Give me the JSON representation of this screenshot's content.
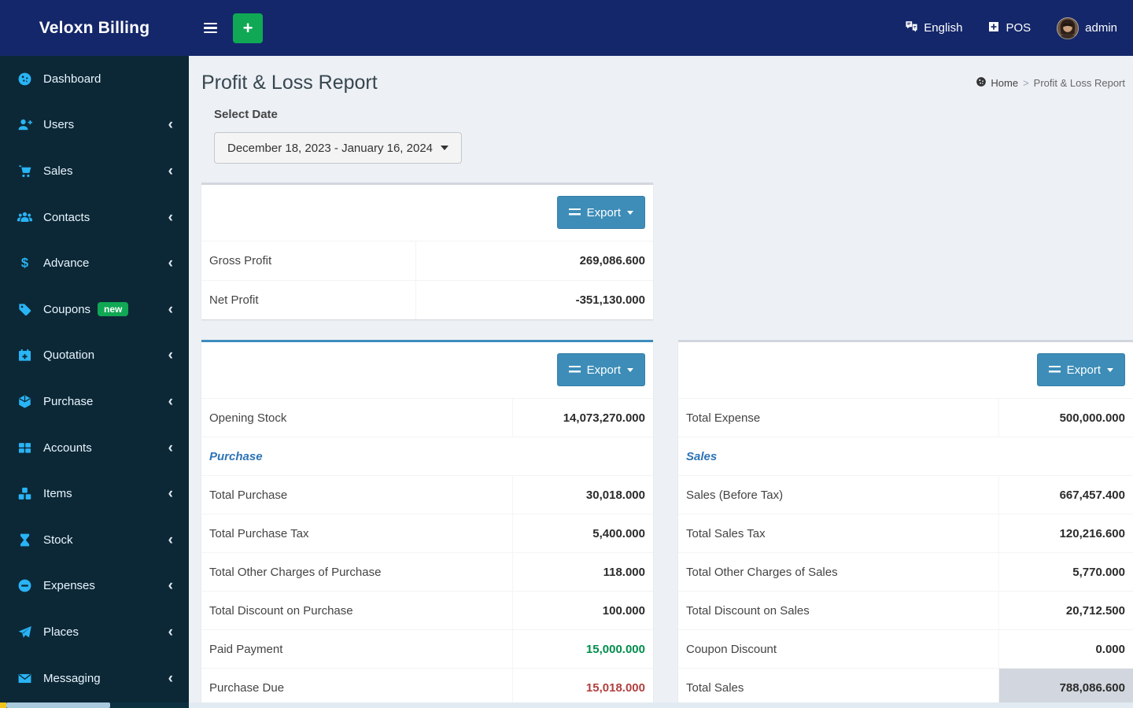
{
  "app": {
    "title": "Veloxn Billing"
  },
  "navbar": {
    "language_label": "English",
    "pos_label": "POS",
    "user_name": "admin"
  },
  "sidebar": {
    "items": [
      {
        "id": "dashboard",
        "label": "Dashboard",
        "icon": "dashboard-icon",
        "chevron": false
      },
      {
        "id": "users",
        "label": "Users",
        "icon": "users-icon",
        "chevron": true
      },
      {
        "id": "sales",
        "label": "Sales",
        "icon": "sales-icon",
        "chevron": true
      },
      {
        "id": "contacts",
        "label": "Contacts",
        "icon": "contacts-icon",
        "chevron": true
      },
      {
        "id": "advance",
        "label": "Advance",
        "icon": "advance-icon",
        "chevron": true
      },
      {
        "id": "coupons",
        "label": "Coupons",
        "icon": "coupons-icon",
        "chevron": true,
        "badge": "new"
      },
      {
        "id": "quotation",
        "label": "Quotation",
        "icon": "quotation-icon",
        "chevron": true
      },
      {
        "id": "purchase",
        "label": "Purchase",
        "icon": "purchase-icon",
        "chevron": true
      },
      {
        "id": "accounts",
        "label": "Accounts",
        "icon": "accounts-icon",
        "chevron": true
      },
      {
        "id": "items",
        "label": "Items",
        "icon": "items-icon",
        "chevron": true
      },
      {
        "id": "stock",
        "label": "Stock",
        "icon": "stock-icon",
        "chevron": true
      },
      {
        "id": "expenses",
        "label": "Expenses",
        "icon": "expenses-icon",
        "chevron": true
      },
      {
        "id": "places",
        "label": "Places",
        "icon": "places-icon",
        "chevron": true
      },
      {
        "id": "messaging",
        "label": "Messaging",
        "icon": "messaging-icon",
        "chevron": true
      }
    ]
  },
  "page": {
    "title": "Profit & Loss Report",
    "breadcrumb": {
      "home": "Home",
      "separator": ">",
      "current": "Profit & Loss Report"
    },
    "select_date_label": "Select Date",
    "date_range": "December 18, 2023 - January 16, 2024"
  },
  "labels": {
    "export": "Export"
  },
  "cards": {
    "summary": {
      "rows": [
        {
          "label": "Gross Profit",
          "value": "269,086.600"
        },
        {
          "label": "Net Profit",
          "value": "-351,130.000"
        }
      ]
    },
    "purchase": {
      "rows": [
        {
          "label": "Opening Stock",
          "value": "14,073,270.000"
        },
        {
          "type": "section",
          "label": "Purchase"
        },
        {
          "label": "Total Purchase",
          "value": "30,018.000"
        },
        {
          "label": "Total Purchase Tax",
          "value": "5,400.000"
        },
        {
          "label": "Total Other Charges of Purchase",
          "value": "118.000"
        },
        {
          "label": "Total Discount on Purchase",
          "value": "100.000"
        },
        {
          "label": "Paid Payment",
          "value": "15,000.000",
          "value_color": "green"
        },
        {
          "label": "Purchase Due",
          "value": "15,018.000",
          "value_color": "red"
        }
      ]
    },
    "sales": {
      "rows": [
        {
          "label": "Total Expense",
          "value": "500,000.000"
        },
        {
          "type": "section",
          "label": "Sales"
        },
        {
          "label": "Sales (Before Tax)",
          "value": "667,457.400"
        },
        {
          "label": "Total Sales Tax",
          "value": "120,216.600"
        },
        {
          "label": "Total Other Charges of Sales",
          "value": "5,770.000"
        },
        {
          "label": "Total Discount on Sales",
          "value": "20,712.500"
        },
        {
          "label": "Coupon Discount",
          "value": "0.000"
        },
        {
          "label": "Total Sales",
          "value": "788,086.600",
          "value_bg": "highlight"
        }
      ]
    }
  },
  "colors": {
    "navbar_bg": "#14276a",
    "sidebar_bg": "#0c2836",
    "sidebar_icon": "#29b4f5",
    "accent_blue": "#3c8dbc",
    "button_blue": "#3d8db8",
    "green": "#008d4c",
    "red": "#b23f3f",
    "badge_green": "#10a854",
    "section_blue": "#2e74b5",
    "highlight": "#d2d6de"
  }
}
